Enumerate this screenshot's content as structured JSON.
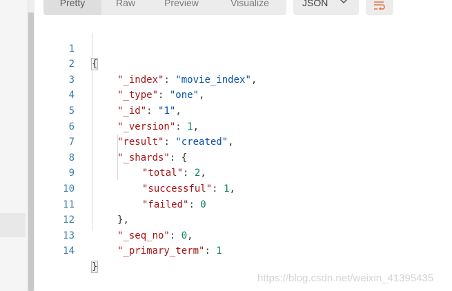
{
  "toolbar": {
    "tabs": [
      {
        "label": "Pretty",
        "active": true
      },
      {
        "label": "Raw",
        "active": false
      },
      {
        "label": "Preview",
        "active": false
      },
      {
        "label": "Visualize",
        "active": false
      }
    ],
    "format": "JSON",
    "wrap_icon": "wrap-lines-icon"
  },
  "editor": {
    "line_numbers": [
      "1",
      "2",
      "3",
      "4",
      "5",
      "6",
      "7",
      "8",
      "9",
      "10",
      "11",
      "12",
      "13",
      "14"
    ],
    "lines": [
      {
        "open": "{"
      },
      {
        "key": "\"_index\"",
        "value": "\"movie_index\"",
        "trail": ","
      },
      {
        "key": "\"_type\"",
        "value": "\"one\"",
        "trail": ","
      },
      {
        "key": "\"_id\"",
        "value": "\"1\"",
        "trail": ","
      },
      {
        "key": "\"_version\"",
        "value": "1",
        "trail": ","
      },
      {
        "key": "\"result\"",
        "value": "\"created\"",
        "trail": ","
      },
      {
        "key": "\"_shards\"",
        "value": "{",
        "trail": ""
      },
      {
        "key": "\"total\"",
        "value": "2",
        "trail": ","
      },
      {
        "key": "\"successful\"",
        "value": "1",
        "trail": ","
      },
      {
        "key": "\"failed\"",
        "value": "0",
        "trail": ""
      },
      {
        "close": "}",
        "trail": ","
      },
      {
        "key": "\"_seq_no\"",
        "value": "0",
        "trail": ","
      },
      {
        "key": "\"_primary_term\"",
        "value": "1",
        "trail": ""
      },
      {
        "close": "}"
      }
    ],
    "colors": {
      "key": "#a31515",
      "string": "#0451a5",
      "number": "#098658",
      "line_number": "#3b7ea8"
    }
  },
  "watermark": "https://blog.csdn.net/weixin_41395435"
}
